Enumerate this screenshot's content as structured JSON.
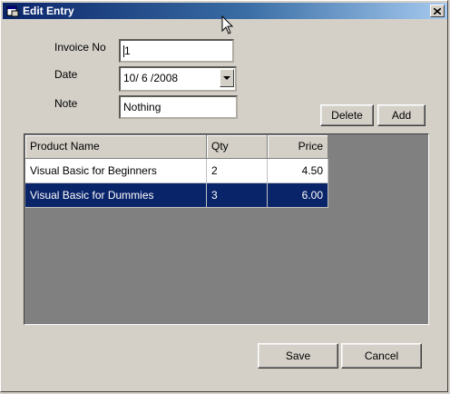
{
  "window": {
    "title": "Edit Entry",
    "icon": "window-app-icon",
    "close_glyph": "×"
  },
  "form": {
    "invoice_label": "Invoice No",
    "invoice_value": "1",
    "date_label": "Date",
    "date_value": "10/ 6 /2008",
    "note_label": "Note",
    "note_value": "Nothing"
  },
  "buttons": {
    "delete": "Delete",
    "add": "Add",
    "save": "Save",
    "cancel": "Cancel"
  },
  "grid": {
    "columns": [
      "Product Name",
      "Qty",
      "Price"
    ],
    "rows": [
      [
        "Visual Basic for Beginners",
        "2",
        "4.50"
      ],
      [
        "Visual Basic for Dummies",
        "3",
        "6.00"
      ]
    ],
    "selected_row": 1
  },
  "colors": {
    "titlebar": "#0a246a",
    "face": "#d4d0c8",
    "selection": "#0a246a",
    "grid_background": "#808080"
  }
}
